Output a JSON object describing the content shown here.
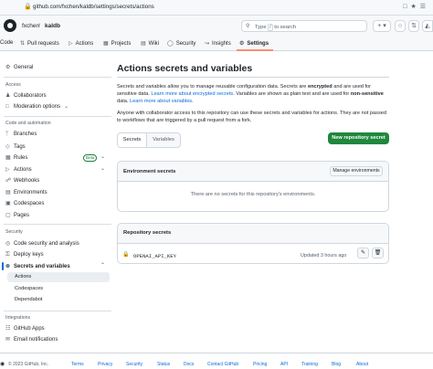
{
  "browser": {
    "url": "github.com/fxchen/kaldb/settings/secrets/actions"
  },
  "header": {
    "owner": "fxchen",
    "separator": "/",
    "repo": "kaldb",
    "search_placeholder": "Type",
    "search_key": "/",
    "search_suffix": "to search"
  },
  "repo_nav": {
    "items": [
      "Code",
      "Pull requests",
      "Actions",
      "Projects",
      "Wiki",
      "Security",
      "Insights",
      "Settings"
    ],
    "active": "Settings"
  },
  "sidebar": {
    "general": "General",
    "access_heading": "Access",
    "collaborators": "Collaborators",
    "moderation": "Moderation options",
    "code_heading": "Code and automation",
    "branches": "Branches",
    "tags": "Tags",
    "rules": "Rules",
    "rules_badge": "Beta",
    "actions": "Actions",
    "webhooks": "Webhooks",
    "environments": "Environments",
    "codespaces": "Codespaces",
    "pages": "Pages",
    "security_heading": "Security",
    "code_security": "Code security and analysis",
    "deploy_keys": "Deploy keys",
    "secrets_vars": "Secrets and variables",
    "sub_actions": "Actions",
    "sub_codespaces": "Codespaces",
    "sub_dependabot": "Dependabot",
    "integrations_heading": "Integrations",
    "github_apps": "GitHub Apps",
    "email_notifications": "Email notifications"
  },
  "main": {
    "title": "Actions secrets and variables",
    "p1_a": "Secrets and variables allow you to manage reusable configuration data. Secrets are ",
    "p1_b": "encrypted",
    "p1_c": " and are used for sensitive data. ",
    "p1_link1": "Learn more about encrypted secrets",
    "p1_d": ". Variables are shown as plain text and are used for ",
    "p1_e": "non-sensitive",
    "p1_f": " data. ",
    "p1_link2": "Learn more about variables",
    "p1_g": ".",
    "p2": "Anyone with collaborator access to this repository can use these secrets and variables for actions. They are not passed to workflows that are triggered by a pull request from a fork.",
    "tab_secrets": "Secrets",
    "tab_variables": "Variables",
    "new_secret_button": "New repository secret",
    "env_title": "Environment secrets",
    "manage_env_button": "Manage environments",
    "env_empty": "There are no secrets for this repository's environments.",
    "repo_title": "Repository secrets",
    "secret_name": "OPENAI_API_KEY",
    "secret_updated": "Updated 3 hours ago"
  },
  "footer": {
    "copyright": "© 2023 GitHub, Inc.",
    "links": [
      "Terms",
      "Privacy",
      "Security",
      "Status",
      "Docs",
      "Contact GitHub",
      "Pricing",
      "API",
      "Training",
      "Blog",
      "About"
    ]
  },
  "colors": {
    "accent": "#0969da",
    "primary_button": "#1f883d",
    "active_tab_underline": "#fd8c73"
  }
}
